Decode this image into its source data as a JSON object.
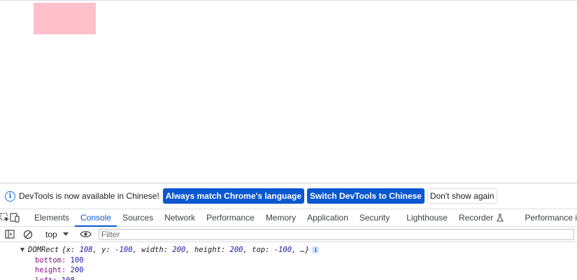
{
  "infobar": {
    "message": "DevTools is now available in Chinese!",
    "btn_match": "Always match Chrome's language",
    "btn_switch": "Switch DevTools to Chinese",
    "btn_dismiss": "Don't show again"
  },
  "tabs": [
    {
      "label": "Elements"
    },
    {
      "label": "Console"
    },
    {
      "label": "Sources"
    },
    {
      "label": "Network"
    },
    {
      "label": "Performance"
    },
    {
      "label": "Memory"
    },
    {
      "label": "Application"
    },
    {
      "label": "Security"
    },
    {
      "label": "Lighthouse"
    },
    {
      "label": "Recorder"
    },
    {
      "label": "Performance in"
    }
  ],
  "active_tab": "Console",
  "console_toolbar": {
    "context": "top",
    "filter_placeholder": "Filter"
  },
  "output": {
    "type": "DOMRect",
    "preview": {
      "open": "{",
      "x_key": "x: ",
      "x_val": "108",
      "y_key": ", y: ",
      "y_val": "-100",
      "w_key": ", width: ",
      "w_val": "200",
      "h_key": ", height: ",
      "h_val": "200",
      "t_key": ", top: ",
      "t_val": "-100",
      "close": ", …}"
    },
    "props": [
      {
        "key": "bottom",
        "value": "100"
      },
      {
        "key": "height",
        "value": "200"
      },
      {
        "key": "left",
        "value": "108"
      }
    ]
  },
  "colors": {
    "box": "#ffc0cb",
    "accent": "#0b57d0"
  },
  "icons": [
    "info-icon",
    "inspect-element-icon",
    "device-toolbar-icon",
    "sidebar-toggle-icon",
    "clear-console-icon",
    "eye-icon",
    "flask-icon"
  ]
}
